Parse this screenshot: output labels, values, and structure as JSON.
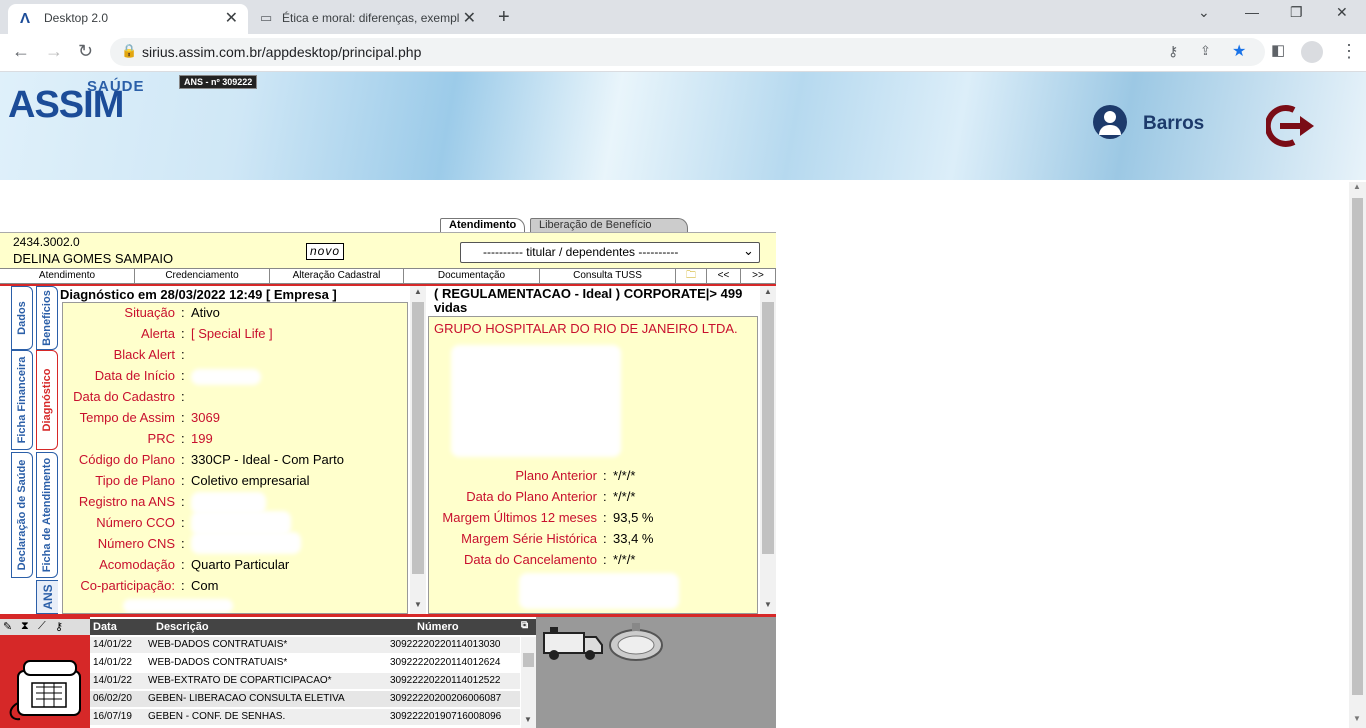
{
  "browser": {
    "tabs": [
      {
        "title": "Desktop 2.0",
        "active": true
      },
      {
        "title": "Ética e moral: diferenças, exempl",
        "active": false
      }
    ],
    "url": "sirius.assim.com.br/appdesktop/principal.php"
  },
  "header": {
    "logo_saude": "SAÚDE",
    "logo_assim": "ASSIM",
    "ans_badge": "ANS - nº 309222",
    "user_name": "Barros"
  },
  "app_tabs": [
    "Atendimento",
    "Liberação de Benefício"
  ],
  "patient": {
    "id": "2434.3002.0",
    "name": "DELINA GOMES SAMPAIO",
    "novo_label": "novo",
    "dependents_select": "---------- titular / dependentes ----------"
  },
  "menu": [
    "Atendimento",
    "Credenciamento",
    "Alteração Cadastral",
    "Documentação",
    "Consulta TUSS",
    "<<",
    ">>"
  ],
  "side_tabs": [
    "Dados",
    "Benefícios",
    "Ficha Financeira",
    "Diagnóstico",
    "Declaração de Saúde",
    "Ficha de Atendimento"
  ],
  "diagnostic": {
    "title": "Diagnóstico em 28/03/2022 12:49 [ Empresa ]",
    "rows": [
      {
        "label": "Situação",
        "value": "Ativo"
      },
      {
        "label": "Alerta",
        "value": "[ Special Life ]"
      },
      {
        "label": "Black Alert",
        "value": ""
      },
      {
        "label": "Data de Início",
        "value": ""
      },
      {
        "label": "Data do Cadastro",
        "value": ""
      },
      {
        "label": "Tempo de Assim",
        "value": "3069"
      },
      {
        "label": "PRC",
        "value": "199"
      },
      {
        "label": "Código do Plano",
        "value": "330CP - Ideal - Com Parto"
      },
      {
        "label": "Tipo de Plano",
        "value": "Coletivo empresarial"
      },
      {
        "label": "Registro na ANS",
        "value": ""
      },
      {
        "label": "Número CCO",
        "value": ""
      },
      {
        "label": "Número CNS",
        "value": ""
      },
      {
        "label": "Acomodação",
        "value": "Quarto Particular"
      },
      {
        "label": "Co-participação:",
        "value": "Com"
      }
    ]
  },
  "company": {
    "title": "( REGULAMENTACAO - Ideal ) CORPORATE|> 499 vidas",
    "name": "GRUPO HOSPITALAR DO RIO DE JANEIRO LTDA.",
    "rows": [
      {
        "label": "Plano Anterior",
        "value": "*/*/*"
      },
      {
        "label": "Data do Plano Anterior",
        "value": "*/*/*"
      },
      {
        "label": "Margem Últimos 12 meses",
        "value": "93,5 %"
      },
      {
        "label": "Margem Série Histórica",
        "value": "33,4 %"
      },
      {
        "label": "Data do Cancelamento",
        "value": "*/*/*"
      }
    ]
  },
  "history": {
    "headers": [
      "Data",
      "Descrição",
      "Número"
    ],
    "rows": [
      {
        "data": "14/01/22",
        "descricao": "WEB-DADOS CONTRATUAIS*",
        "numero": "30922220220114013030"
      },
      {
        "data": "14/01/22",
        "descricao": "WEB-DADOS CONTRATUAIS*",
        "numero": "30922220220114012624"
      },
      {
        "data": "14/01/22",
        "descricao": "WEB-EXTRATO DE COPARTICIPACAO*",
        "numero": "30922220220114012522"
      },
      {
        "data": "06/02/20",
        "descricao": "GEBEN- LIBERACAO CONSULTA ELETIVA",
        "numero": "30922220200206006087"
      },
      {
        "data": "16/07/19",
        "descricao": "GEBEN - CONF. DE SENHAS.",
        "numero": "30922220190716008096"
      }
    ]
  },
  "colors": {
    "accent_red": "#d62828",
    "brand_blue": "#1c4c98",
    "panel_yellow": "#ffffcc"
  }
}
